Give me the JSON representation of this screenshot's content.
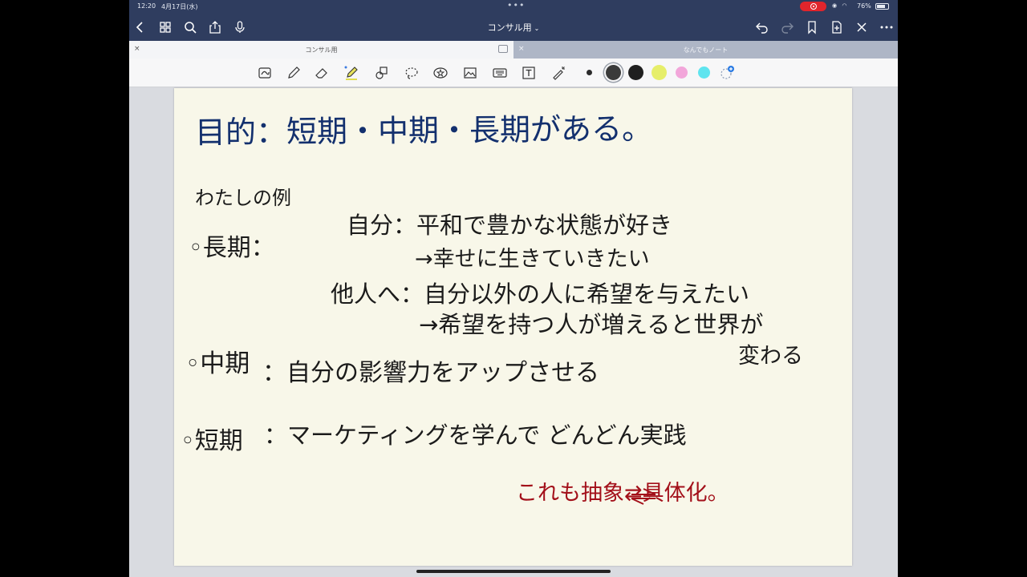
{
  "status_bar": {
    "time": "12:20",
    "date": "4月17日(水)",
    "battery_percent": "76%",
    "battery_level": 0.76,
    "recording": true
  },
  "nav_bar": {
    "title": "コンサル用",
    "icons": [
      "back-icon",
      "grid-icon",
      "search-icon",
      "share-icon",
      "mic-icon",
      "undo-icon",
      "redo-icon",
      "bookmark-icon",
      "add-page-icon",
      "close-icon",
      "more-icon"
    ]
  },
  "tabs": [
    {
      "label": "コンサル用",
      "active": true
    },
    {
      "label": "なんでもノート",
      "active": false
    }
  ],
  "toolbar": {
    "tools": [
      "lasso-text-icon",
      "pen-icon",
      "eraser-icon",
      "highlighter-icon",
      "shapes-icon",
      "lasso-icon",
      "sticker-icon",
      "image-icon",
      "keyboard-icon",
      "text-box-icon",
      "laser-pointer-icon"
    ],
    "colors": [
      "#2b2b2b",
      "#3a3a3a",
      "#1f1f1f",
      "#e6ee6a",
      "#f2a6da",
      "#5fe4ef"
    ]
  },
  "note": {
    "heading": "目的：短期・中期・長期がある。",
    "example_label": "わたしの例",
    "long_term": {
      "label": "◦長期：",
      "self": "自分：平和で豊かな状態が好き",
      "self_result": "→幸せに生きていきたい",
      "others": "他人へ：自分以外の人に希望を与えたい",
      "others_result": "→希望を持つ人が増えると世界が",
      "others_result_cont": "変わる"
    },
    "mid_term": {
      "label": "◦中期",
      "text": "：自分の影響力をアップさせる"
    },
    "short_term": {
      "label": "◦短期",
      "text": "：マーケティングを学んで どんどん実践"
    },
    "conclusion": "これも抽象⇄具体化。"
  }
}
